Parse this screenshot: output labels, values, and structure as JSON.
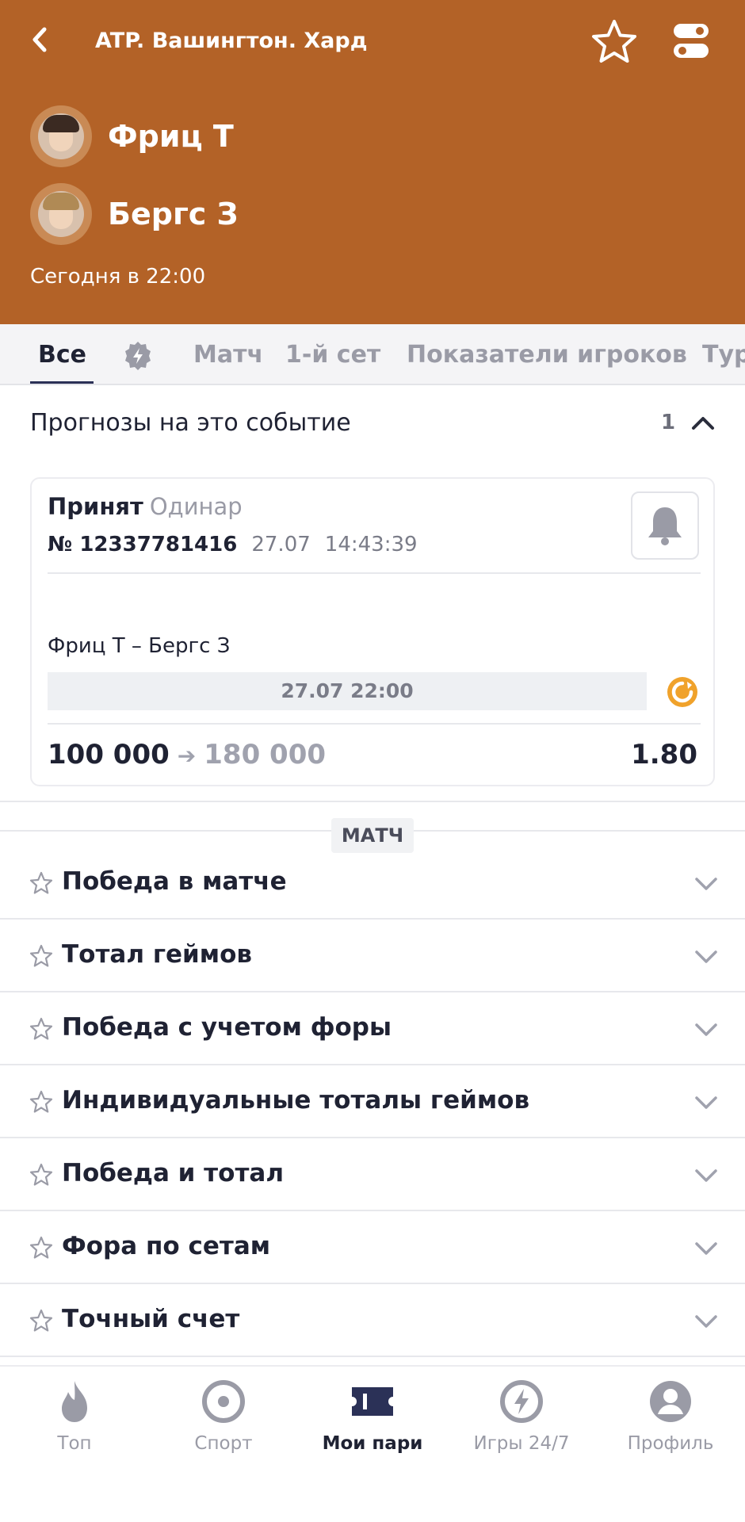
{
  "header": {
    "title": "ATP. Вашингтон. Хард",
    "players": [
      {
        "name": "Фриц Т"
      },
      {
        "name": "Бергс З"
      }
    ],
    "time": "Сегодня в 22:00"
  },
  "tabs": [
    {
      "label": "Все",
      "active": true
    },
    {
      "label": "Матч"
    },
    {
      "label": "1-й сет"
    },
    {
      "label": "Показатели игроков"
    },
    {
      "label": "Тур"
    }
  ],
  "forecasts": {
    "title": "Прогнозы на это событие",
    "count": "1",
    "bet": {
      "status": "Принят",
      "type": "Одинар",
      "number": "№ 12337781416",
      "date": "27.07",
      "time": "14:43:39",
      "event": "Фриц Т – Бергс З",
      "event_date": "27.07 22:00",
      "stake": "100 000",
      "payout": "180 000",
      "coef": "1.80"
    }
  },
  "match_section": {
    "label": "МАТЧ",
    "markets": [
      "Победа в матче",
      "Тотал геймов",
      "Победа с учетом форы",
      "Индивидуальные тоталы геймов",
      "Победа и тотал",
      "Фора по сетам",
      "Точный счет"
    ]
  },
  "bottom_nav": [
    {
      "label": "Топ",
      "icon": "flame-icon"
    },
    {
      "label": "Спорт",
      "icon": "sport-icon"
    },
    {
      "label": "Мои пари",
      "icon": "ticket-icon",
      "active": true
    },
    {
      "label": "Игры 24/7",
      "icon": "lightning-icon"
    },
    {
      "label": "Профиль",
      "icon": "profile-icon"
    }
  ],
  "colors": {
    "header_bg": "#b36227",
    "accent_navy": "#2b3157",
    "pending_orange": "#f0a22b"
  }
}
